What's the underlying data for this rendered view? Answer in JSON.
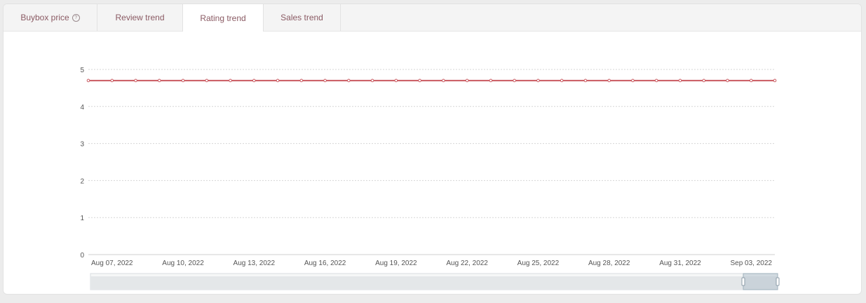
{
  "tabs": [
    {
      "label": "Buybox price",
      "has_help": true
    },
    {
      "label": "Review trend"
    },
    {
      "label": "Rating trend",
      "active": true
    },
    {
      "label": "Sales trend"
    }
  ],
  "colors": {
    "line": "#c9585f",
    "tab_text": "#8a5a63",
    "grid": "#d6d6d6"
  },
  "chart_data": {
    "type": "line",
    "x": [
      "Aug 06, 2022",
      "Aug 07, 2022",
      "Aug 08, 2022",
      "Aug 09, 2022",
      "Aug 10, 2022",
      "Aug 11, 2022",
      "Aug 12, 2022",
      "Aug 13, 2022",
      "Aug 14, 2022",
      "Aug 15, 2022",
      "Aug 16, 2022",
      "Aug 17, 2022",
      "Aug 18, 2022",
      "Aug 19, 2022",
      "Aug 20, 2022",
      "Aug 21, 2022",
      "Aug 22, 2022",
      "Aug 23, 2022",
      "Aug 24, 2022",
      "Aug 25, 2022",
      "Aug 26, 2022",
      "Aug 27, 2022",
      "Aug 28, 2022",
      "Aug 29, 2022",
      "Aug 30, 2022",
      "Aug 31, 2022",
      "Sep 01, 2022",
      "Sep 02, 2022",
      "Sep 03, 2022",
      "Sep 04, 2022"
    ],
    "series": [
      {
        "values": [
          4.7,
          4.7,
          4.7,
          4.7,
          4.7,
          4.7,
          4.7,
          4.7,
          4.7,
          4.7,
          4.7,
          4.7,
          4.7,
          4.7,
          4.7,
          4.7,
          4.7,
          4.7,
          4.7,
          4.7,
          4.7,
          4.7,
          4.7,
          4.7,
          4.7,
          4.7,
          4.7,
          4.7,
          4.7,
          4.7
        ]
      }
    ],
    "x_tick_labels": [
      "Aug 07, 2022",
      "Aug 10, 2022",
      "Aug 13, 2022",
      "Aug 16, 2022",
      "Aug 19, 2022",
      "Aug 22, 2022",
      "Aug 25, 2022",
      "Aug 28, 2022",
      "Aug 31, 2022",
      "Sep 03, 2022"
    ],
    "y_ticks": [
      0,
      1,
      2,
      3,
      4,
      5
    ],
    "ylim": [
      0,
      5
    ],
    "grid": true,
    "title": "",
    "xlabel": "",
    "ylabel": "",
    "data_zoom": {
      "selected_start_fraction": 0.95,
      "selected_end_fraction": 1.0
    }
  }
}
